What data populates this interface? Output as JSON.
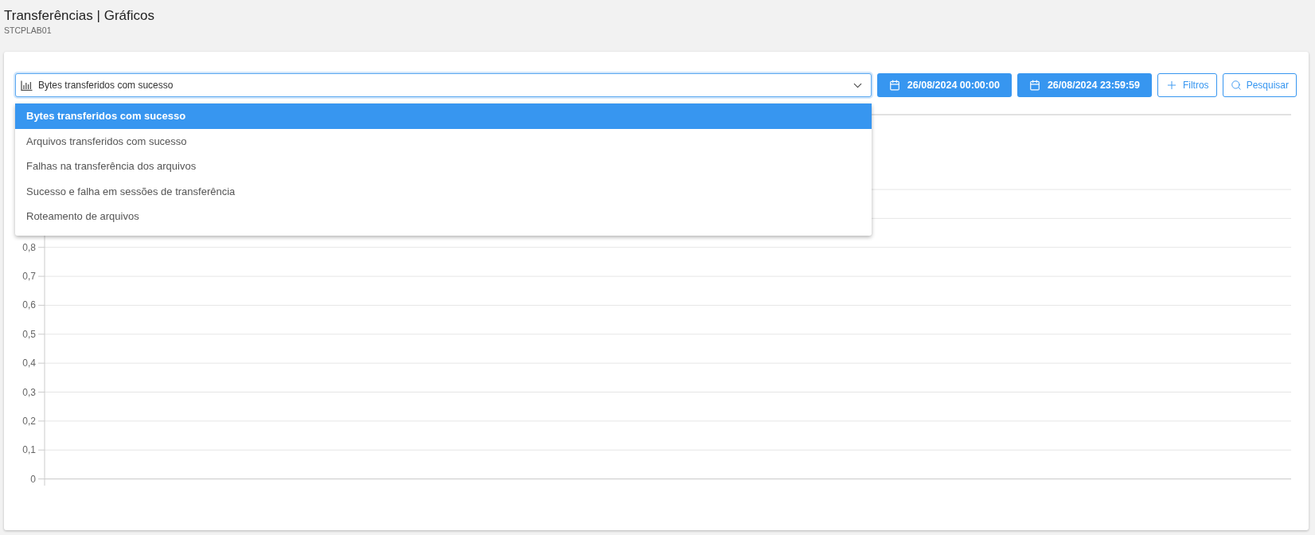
{
  "header": {
    "title": "Transferências | Gráficos",
    "subtitle": "STCPLAB01"
  },
  "toolbar": {
    "chart_select": {
      "value": "Bytes transferidos com sucesso",
      "expanded": true,
      "options": [
        {
          "label": "Bytes transferidos com sucesso",
          "selected": true
        },
        {
          "label": "Arquivos transferidos com sucesso",
          "selected": false
        },
        {
          "label": "Falhas na transferência dos arquivos",
          "selected": false
        },
        {
          "label": "Sucesso e falha em sessões de transferência",
          "selected": false
        },
        {
          "label": "Roteamento de arquivos",
          "selected": false
        }
      ]
    },
    "buttons": [
      {
        "kind": "date",
        "label": "26/08/2024 00:00:00"
      },
      {
        "kind": "date",
        "label": "26/08/2024 23:59:59"
      },
      {
        "kind": "filter",
        "label": "Filtros"
      },
      {
        "kind": "search",
        "label": "Pesquisar"
      }
    ]
  },
  "chart": {
    "chart_data": {
      "type": "line",
      "categories": [
        null
      ],
      "grid": true,
      "ylim": [
        0,
        1
      ],
      "yticks": [
        {
          "value": 0,
          "label": "0"
        },
        {
          "value": 0.1,
          "label": "0,1"
        },
        {
          "value": 0.2,
          "label": "0,2"
        },
        {
          "value": 0.3,
          "label": "0,3"
        },
        {
          "value": 0.4,
          "label": "0,4"
        },
        {
          "value": 0.5,
          "label": "0,5"
        },
        {
          "value": 0.6,
          "label": "0,6"
        },
        {
          "value": 0.7,
          "label": "0,7"
        },
        {
          "value": 0.8,
          "label": "0,8"
        }
      ]
    }
  }
}
